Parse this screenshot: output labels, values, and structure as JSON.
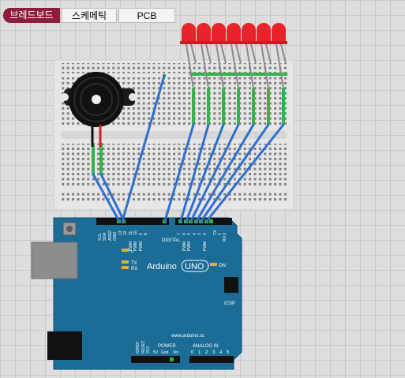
{
  "tabs": [
    {
      "label": "브레드보드",
      "active": true
    },
    {
      "label": "스케메틱",
      "active": false
    },
    {
      "label": "PCB",
      "active": false
    }
  ],
  "arduino": {
    "brand": "Arduino",
    "model": "UNO",
    "website": "www.arduino.cc",
    "labels": {
      "digital": "DIGITAL",
      "scl": "SCL",
      "sda": "SDA",
      "aref": "AREF",
      "gnd": "GND",
      "pin13": "13",
      "pin12": "12",
      "pin11": "11",
      "pin10": "10",
      "pin9": "9",
      "pin8": "8",
      "pin7": "7",
      "pin6": "6",
      "pin5": "5",
      "pin4": "4",
      "pin3": "3",
      "pin2": "2",
      "tx": "TX",
      "rx": "RX",
      "pin1": "1",
      "pin0": "0",
      "pwm": "PWM",
      "led_l": "L",
      "led_tx": "TX",
      "led_rx": "RX",
      "on": "ON",
      "icsp": "ICSP",
      "ioref": "IOREF",
      "reset": "RESET",
      "v33": "3V3",
      "v5": "5V",
      "gnd1": "Gnd",
      "vin": "Vin",
      "power": "POWER",
      "analog_in": "ANALOG IN",
      "a0": "0",
      "a1": "1",
      "a2": "2",
      "a3": "3",
      "a4": "4",
      "a5": "5"
    }
  },
  "colors": {
    "breadboard_tab": "#8e1c3c",
    "board": "#1b6c96",
    "wire": "#2f6fcf",
    "led": "#e8242a"
  }
}
